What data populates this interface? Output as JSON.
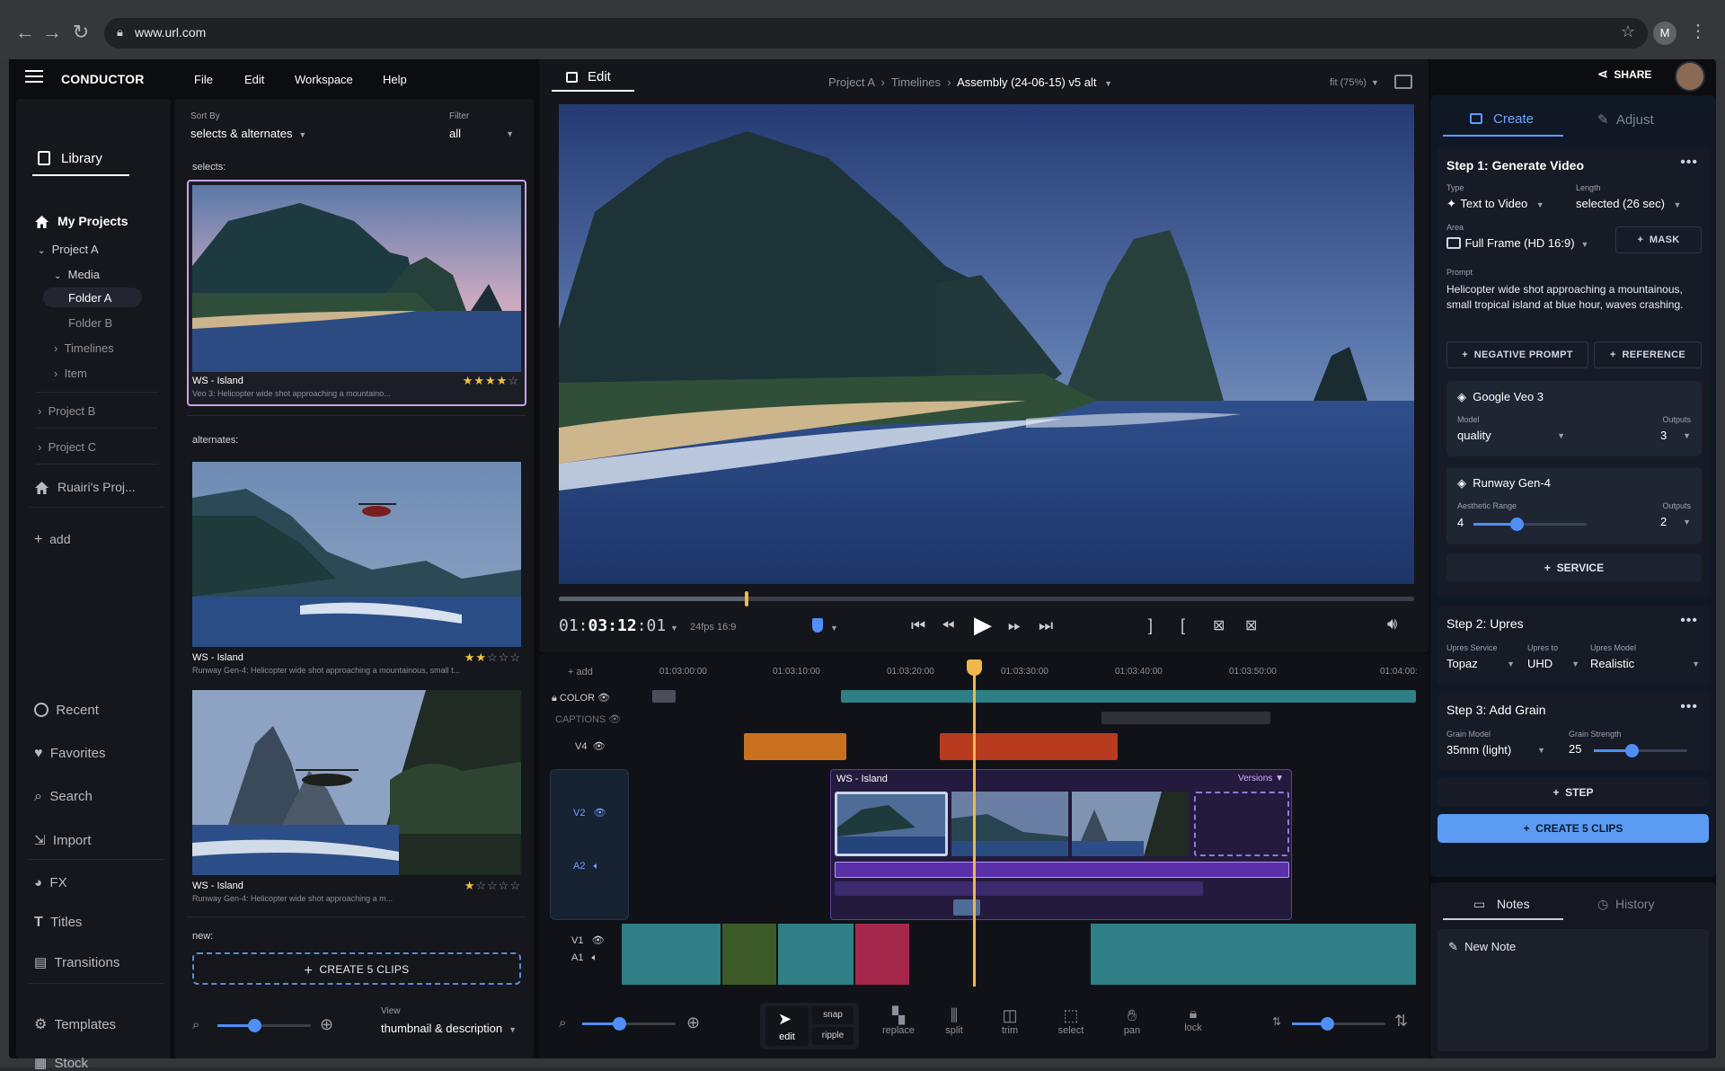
{
  "browser": {
    "url": "www.url.com",
    "profile_initial": "M"
  },
  "app": {
    "name": "CONDUCTOR",
    "menu": [
      "File",
      "Edit",
      "Workspace",
      "Help"
    ],
    "share_label": "SHARE"
  },
  "library": {
    "tab_label": "Library",
    "tree": {
      "my_projects": "My Projects",
      "project_a": "Project A",
      "media": "Media",
      "folder_a": "Folder A",
      "folder_b": "Folder B",
      "timelines": "Timelines",
      "item": "Item",
      "project_b": "Project B",
      "project_c": "Project C",
      "ruairi": "Ruairi's Proj...",
      "add": "add"
    },
    "nav_bottom": [
      "Recent",
      "Favorites",
      "Search",
      "Import",
      "FX",
      "Titles",
      "Transitions",
      "Templates",
      "Stock"
    ],
    "sort_by_label": "Sort By",
    "sort_by_value": "selects & alternates",
    "filter_label": "Filter",
    "filter_value": "all",
    "sections": {
      "selects": "selects:",
      "alternates": "alternates:",
      "new": "new:"
    },
    "clips": [
      {
        "title": "WS - Island",
        "sub": "Veo 3:  Helicopter wide shot approaching a mountaino...",
        "rating": 4
      },
      {
        "title": "WS - Island",
        "sub": "Runway Gen-4:  Helicopter wide shot approaching a mountainous, small t...",
        "rating": 2
      },
      {
        "title": "WS - Island",
        "sub": "Runway Gen-4:  Helicopter wide shot approaching a m...",
        "rating": 1
      }
    ],
    "create_clips_label": "CREATE 5 CLIPS",
    "view_label": "View",
    "view_value": "thumbnail & description"
  },
  "viewer": {
    "tab_label": "Edit",
    "breadcrumb": [
      "Project A",
      "Timelines",
      "Assembly (24-06-15) v5 alt"
    ],
    "fit_label": "fit (75%)",
    "timecode_prefix": "01:",
    "timecode_main": "03:12",
    "timecode_suffix": ":01",
    "format": "24fps 16:9",
    "playhead_fraction": 0.22
  },
  "timeline": {
    "add_label": "+ add",
    "ticks": [
      "01:03:00:00",
      "01:03:10:00",
      "01:03:20:00",
      "01:03:30:00",
      "01:03:40:00",
      "01:03:50:00",
      "01:04:00:"
    ],
    "tracks": [
      "COLOR",
      "CAPTIONS",
      "V4",
      "V2",
      "A2",
      "V1",
      "A1"
    ],
    "clip_title": "WS - Island",
    "versions_label": "Versions",
    "tools": [
      {
        "name": "edit",
        "label": "edit"
      },
      {
        "name": "replace",
        "label": "replace"
      },
      {
        "name": "split",
        "label": "split"
      },
      {
        "name": "trim",
        "label": "trim"
      },
      {
        "name": "select",
        "label": "select"
      },
      {
        "name": "pan",
        "label": "pan"
      },
      {
        "name": "lock",
        "label": "lock"
      }
    ],
    "snap_label": "snap",
    "ripple_label": "ripple"
  },
  "right": {
    "tabs": [
      "Create",
      "Adjust"
    ],
    "step1": {
      "title": "Step 1: Generate Video",
      "type_label": "Type",
      "type_value": "Text to Video",
      "length_label": "Length",
      "length_value": "selected (26 sec)",
      "area_label": "Area",
      "area_value": "Full Frame (HD 16:9)",
      "mask_label": "MASK",
      "prompt_label": "Prompt",
      "prompt_text": "Helicopter wide shot approaching a mountainous, small tropical island at blue hour, waves crashing.",
      "neg_prompt_label": "NEGATIVE PROMPT",
      "reference_label": "REFERENCE",
      "services": [
        {
          "name": "Google Veo 3",
          "left_label": "Model",
          "left_value": "quality",
          "outputs_label": "Outputs",
          "outputs": "3"
        },
        {
          "name": "Runway Gen-4",
          "left_label": "Aesthetic Range",
          "left_value": "4",
          "outputs_label": "Outputs",
          "outputs": "2",
          "slider_fraction": 0.38
        }
      ],
      "service_label": "SERVICE"
    },
    "step2": {
      "title": "Step 2: Upres",
      "service_label": "Upres Service",
      "service_value": "Topaz",
      "to_label": "Upres to",
      "to_value": "UHD",
      "model_label": "Upres Model",
      "model_value": "Realistic"
    },
    "step3": {
      "title": "Step 3: Add Grain",
      "model_label": "Grain Model",
      "model_value": "35mm (light)",
      "strength_label": "Grain Strength",
      "strength_value": "25",
      "strength_fraction": 0.4
    },
    "step_label": "STEP",
    "create_label": "CREATE 5 CLIPS",
    "notes_tabs": [
      "Notes",
      "History"
    ],
    "new_note_label": "New Note"
  },
  "colors": {
    "accent": "#4f8ff7",
    "selected_border": "#c9a3f0",
    "playhead": "#f0b84a",
    "teal_clip": "#2f7f86",
    "orange_clip": "#c9711e",
    "red_clip": "#b83b1f",
    "purple_clip": "#5a2fa8"
  }
}
